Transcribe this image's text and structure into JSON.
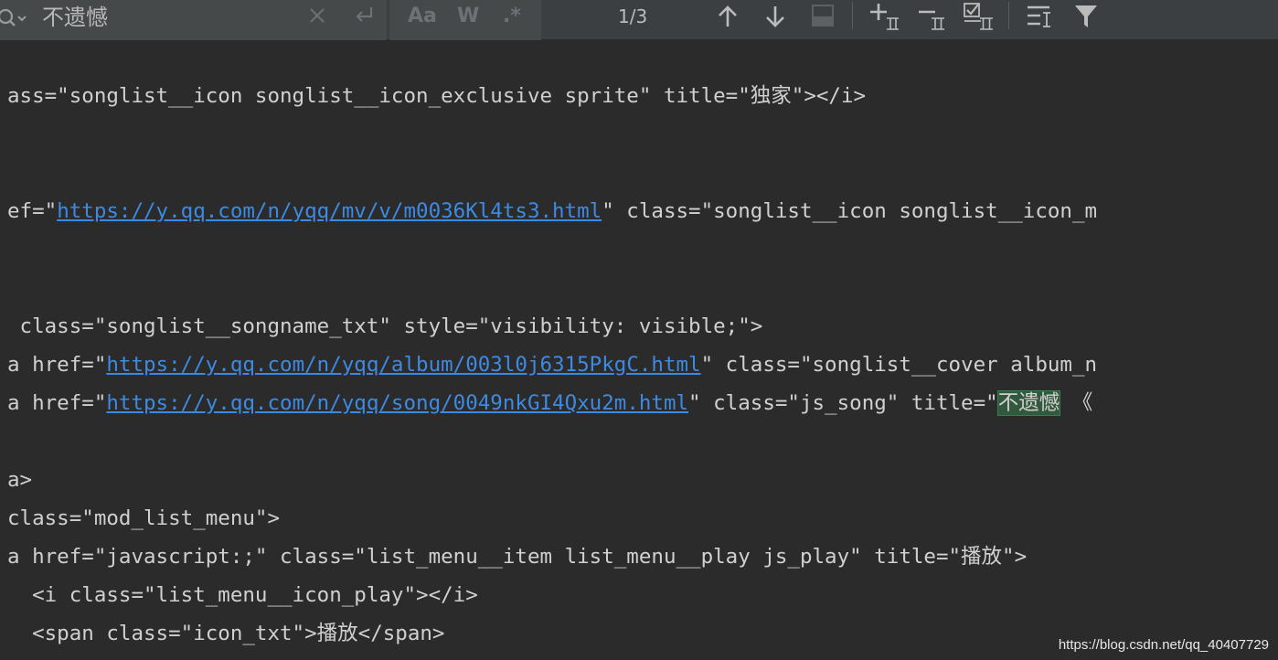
{
  "find_bar": {
    "query": "不遗憾",
    "options": {
      "match_case": "Aa",
      "words": "W",
      "regex": ".*"
    },
    "match_count": "1/3",
    "icons": [
      "search-icon",
      "clear-icon",
      "history-icon",
      "match-case-icon",
      "words-icon",
      "regex-icon",
      "prev-occurrence-icon",
      "next-occurrence-icon",
      "open-in-window-icon",
      "add-selection-icon",
      "remove-selection-icon",
      "select-all-icon",
      "multiline-icon",
      "filter-icon"
    ]
  },
  "code_lines": [
    {
      "parts": [
        {
          "t": "ass=\"songlist__icon songlist__icon_exclusive sprite\" title=\"独家\"></i>"
        }
      ]
    },
    {
      "parts": [
        {
          "t": "ef=\""
        },
        {
          "t": "https://y.qq.com/n/yqq/mv/v/m0036Kl4ts3.html",
          "u": true
        },
        {
          "t": "\" class=\"songlist__icon songlist__icon_m"
        }
      ]
    },
    {
      "parts": [
        {
          "t": " class=\"songlist__songname_txt\" style=\"visibility: visible;\">"
        }
      ]
    },
    {
      "parts": [
        {
          "t": "a href=\""
        },
        {
          "t": "https://y.qq.com/n/yqq/album/003l0j6315PkgC.html",
          "u": true
        },
        {
          "t": "\" class=\"songlist__cover album_n"
        }
      ]
    },
    {
      "parts": [
        {
          "t": "a href=\""
        },
        {
          "t": "https://y.qq.com/n/yqq/song/0049nkGI4Qxu2m.html",
          "u": true
        },
        {
          "t": "\" class=\"js_song\" title=\""
        },
        {
          "t": "不遗憾",
          "h": true
        },
        {
          "t": " 《"
        }
      ]
    },
    {
      "parts": [
        {
          "t": "a>"
        }
      ]
    },
    {
      "parts": [
        {
          "t": "class=\"mod_list_menu\">"
        }
      ]
    },
    {
      "parts": [
        {
          "t": "a href=\"javascript:;\" class=\"list_menu__item list_menu__play js_play\" title=\"播放\">"
        }
      ]
    },
    {
      "parts": [
        {
          "t": "  <i class=\"list_menu__icon_play\"></i>"
        }
      ]
    },
    {
      "parts": [
        {
          "t": "  <span class=\"icon_txt\">播放</span>"
        }
      ]
    }
  ],
  "watermark": "https://blog.csdn.net/qq_40407729"
}
